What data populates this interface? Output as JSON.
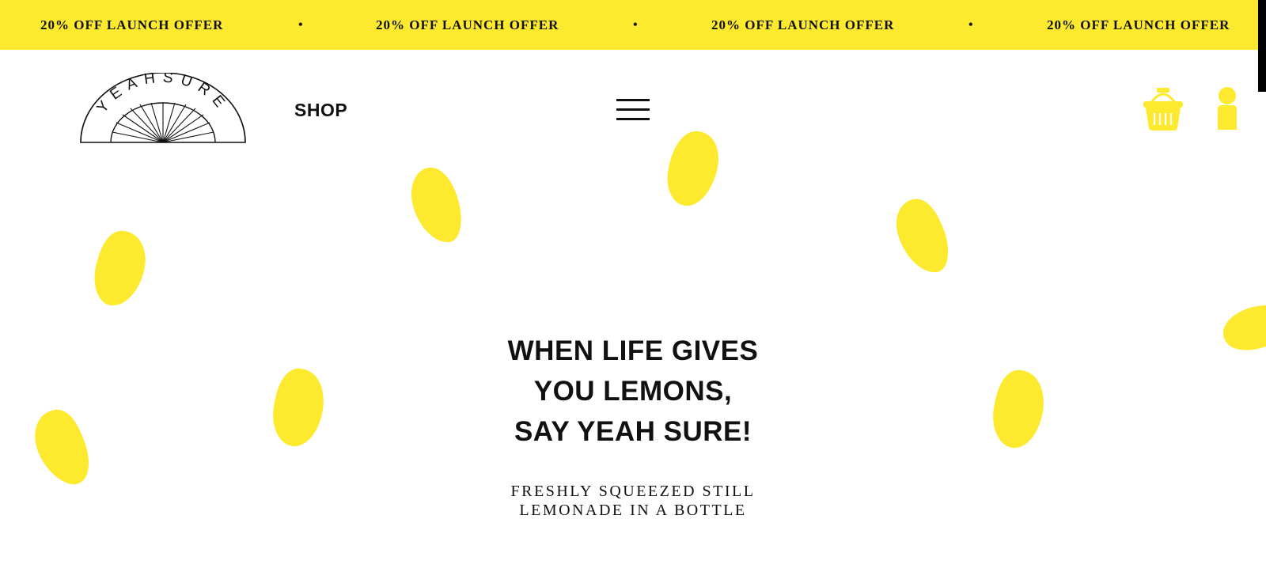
{
  "banner": {
    "items": [
      "20% OFF LAUNCH OFFER",
      "20% OFF LAUNCH OFFER",
      "20% OFF LAUNCH OFFER",
      "20% OFF LAUNCH OFFER"
    ],
    "separator": "•"
  },
  "header": {
    "logo_text": "YEAHSURE",
    "logo_icon": "sunburst-arch-logo",
    "nav": {
      "shop_label": "SHOP"
    },
    "menu_icon": "hamburger-icon",
    "cart_icon": "basket-icon",
    "account_icon": "user-icon"
  },
  "hero": {
    "title_lines": [
      "WHEN LIFE GIVES",
      "YOU LEMONS,",
      "SAY YEAH SURE!"
    ],
    "subtitle_lines": [
      "FRESHLY SQUEEZED STILL",
      "LEMONADE IN A BOTTLE"
    ],
    "decoration_icon": "lemon-drop-icon"
  },
  "colors": {
    "brand_yellow": "#fde92e",
    "text": "#111111",
    "background": "#ffffff"
  }
}
